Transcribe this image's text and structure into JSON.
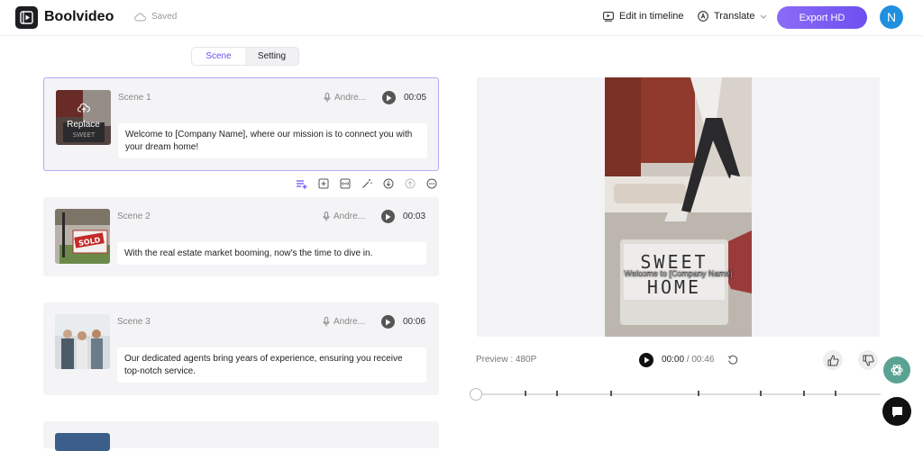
{
  "app": {
    "name": "Boolvideo",
    "saved_label": "Saved"
  },
  "header": {
    "edit_timeline_label": "Edit in timeline",
    "translate_label": "Translate",
    "export_label": "Export HD",
    "avatar_initial": "N"
  },
  "tabs": [
    {
      "label": "Scene",
      "active": true
    },
    {
      "label": "Setting",
      "active": false
    }
  ],
  "scenes": [
    {
      "label": "Scene 1",
      "voice": "Andre...",
      "duration": "00:05",
      "text": "Welcome to [Company Name], where our mission is to connect you with your dream home!",
      "replace_label": "Replace",
      "thumb_text": "SWEET"
    },
    {
      "label": "Scene 2",
      "voice": "Andre...",
      "duration": "00:03",
      "text": "With the real estate market booming, now's the time to dive in.",
      "thumb_text": "SOLD"
    },
    {
      "label": "Scene 3",
      "voice": "Andre...",
      "duration": "00:06",
      "text": "Our dedicated agents bring years of experience, ensuring you receive top-notch service."
    }
  ],
  "preview": {
    "caption": "Welcome to [Company Name]",
    "sign_line1": "SWEET",
    "sign_line2": "HOME",
    "quality_label": "Preview : 480P",
    "current_time": "00:00",
    "separator": " / ",
    "total_time": "00:46"
  },
  "colors": {
    "accent": "#6e4ff0",
    "card": "#f4f4f6",
    "selected_border": "#b9a8f3"
  }
}
